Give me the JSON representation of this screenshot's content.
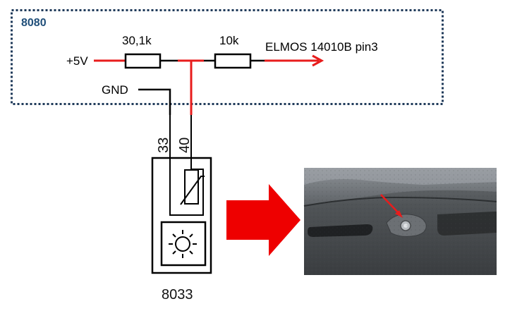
{
  "board": {
    "name": "8080",
    "border_color": "#1f3a5a"
  },
  "circuit": {
    "supply_label": "+5V",
    "ground_label": "GND",
    "resistor_1": "30,1k",
    "resistor_2": "10k",
    "output_label": "ELMOS 14010B pin3",
    "wire_color": "#e81c1c"
  },
  "sensor": {
    "pin_left": "33",
    "pin_right": "40",
    "part_number": "8033",
    "thermistor_icon": "thermistor-icon",
    "light_icon": "sun-icon"
  },
  "arrow": {
    "color": "#ee0000",
    "icon": "right-arrow-icon"
  },
  "photo": {
    "description_icon": "dashboard-photo"
  }
}
